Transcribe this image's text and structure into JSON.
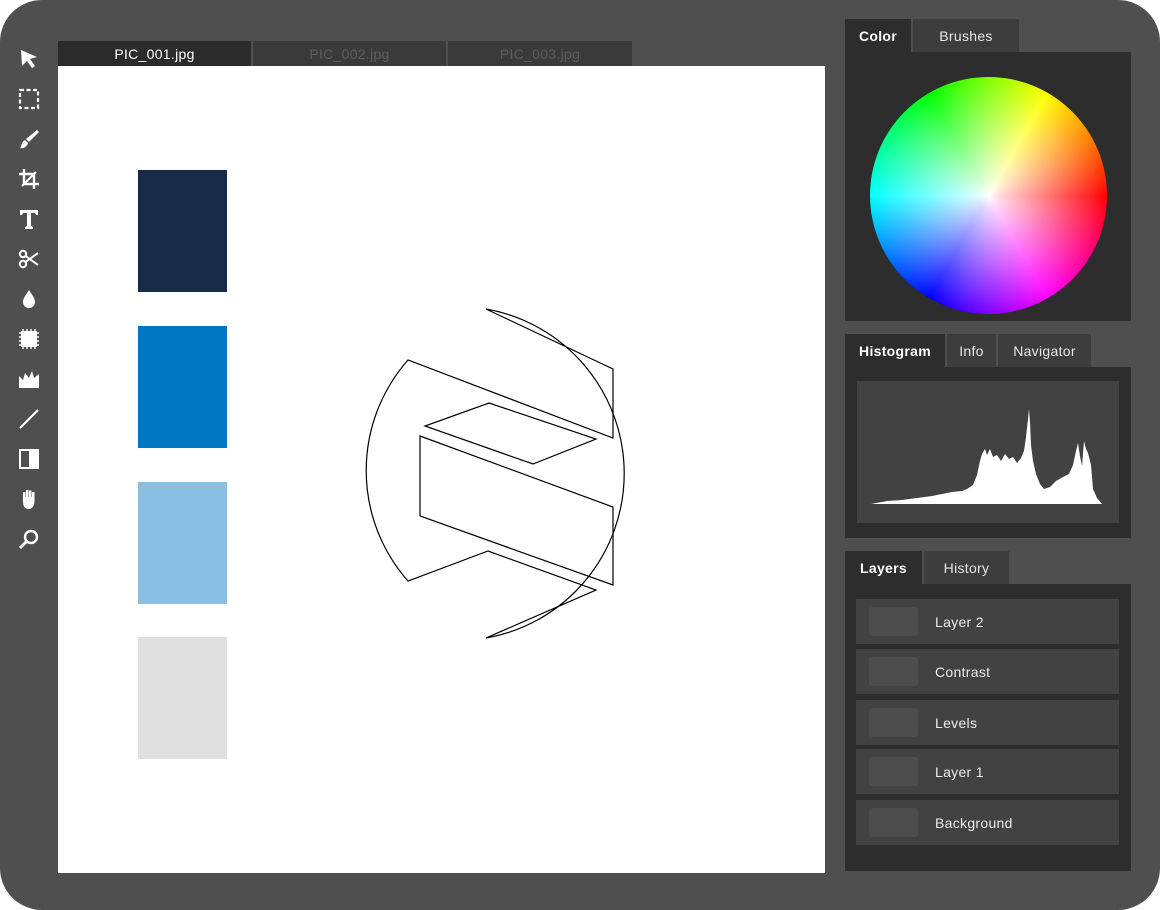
{
  "toolbar": {
    "tools": [
      "select-arrow",
      "marquee-select",
      "brush",
      "crop",
      "text",
      "scissors",
      "drop",
      "stamp",
      "crown",
      "line",
      "contrast",
      "hand",
      "zoom"
    ]
  },
  "document_tabs": [
    {
      "label": "PIC_001.jpg",
      "active": true
    },
    {
      "label": "PIC_002.jpg",
      "active": false
    },
    {
      "label": "PIC_003.jpg",
      "active": false
    }
  ],
  "canvas": {
    "swatches": [
      "#172a47",
      "#0077c2",
      "#88bfe2",
      "#e0e0e0"
    ]
  },
  "color_panel": {
    "tabs": [
      {
        "label": "Color",
        "active": true
      },
      {
        "label": "Brushes",
        "active": false
      }
    ]
  },
  "histogram_panel": {
    "tabs": [
      {
        "label": "Histogram",
        "active": true
      },
      {
        "label": "Info",
        "active": false
      },
      {
        "label": "Navigator",
        "active": false
      }
    ]
  },
  "layers_panel": {
    "tabs": [
      {
        "label": "Layers",
        "active": true
      },
      {
        "label": "History",
        "active": false
      }
    ],
    "layers": [
      "Layer 2",
      "Contrast",
      "Levels",
      "Layer 1",
      "Background"
    ]
  },
  "colors": {
    "frame": "#4f4f4f",
    "panel": "#2d2d2d",
    "accent_text": "#ffffff"
  }
}
